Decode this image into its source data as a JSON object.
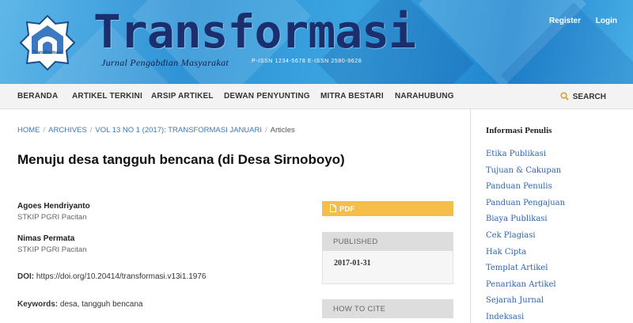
{
  "header": {
    "title": "Transformasi",
    "subtitle": "Jurnal Pengabdian Masyarakat",
    "issn": "P-ISSN 1234-5678   E-ISSN 2580-9628",
    "logo_caption": "Transformasi",
    "register_label": "Register",
    "login_label": "Login",
    "brand_color": "#1b2e6e",
    "accent_color": "#2f93d6"
  },
  "nav": {
    "items": [
      "BERANDA",
      "ARTIKEL TERKINI",
      "ARSIP ARTIKEL",
      "DEWAN PENYUNTING",
      "MITRA BESTARI",
      "NARAHUBUNG"
    ],
    "search_label": "SEARCH",
    "search_icon": "search-icon"
  },
  "breadcrumb": {
    "home": "HOME",
    "archives": "ARCHIVES",
    "issue": "VOL 13 NO 1 (2017): TRANSFORMASI JANUARI",
    "current": "Articles",
    "separator": "/"
  },
  "article": {
    "title": "Menuju desa tangguh bencana (di Desa Sirnoboyo)",
    "authors": [
      {
        "name": "Agoes Hendriyanto",
        "affiliation": "STKIP PGRI Pacitan"
      },
      {
        "name": "Nimas Permata",
        "affiliation": "STKIP PGRI Pacitan"
      }
    ],
    "doi_label": "DOI:",
    "doi_value": "https://doi.org/10.20414/transformasi.v13i1.1976",
    "keywords_label": "Keywords:",
    "keywords_value": "desa, tangguh bencana"
  },
  "details": {
    "pdf_label": "PDF",
    "pdf_color": "#f5be48",
    "published_label": "PUBLISHED",
    "published_date": "2017-01-31",
    "cite_label": "HOW TO CITE"
  },
  "sidebar": {
    "title": "Informasi Penulis",
    "items": [
      "Etika Publikasi",
      "Tujuan & Cakupan",
      "Panduan Penulis",
      "Panduan Pengajuan",
      "Biaya Publikasi",
      "Cek Plagiasi",
      "Hak Cipta",
      "Templat Artikel",
      "Penarikan Artikel",
      "Sejarah Jurnal",
      "Indeksasi"
    ],
    "link_color": "#2d63b0"
  }
}
